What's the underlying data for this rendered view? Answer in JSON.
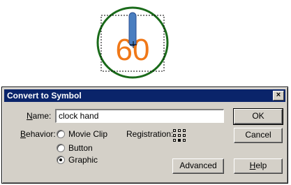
{
  "stage": {
    "symbol_text": "60",
    "circle_color": "#1a6b1a",
    "text_color": "#f07818",
    "hand_color": "#4a7ec0"
  },
  "dialog": {
    "title": "Convert to Symbol",
    "close_glyph": "×",
    "name_label_underlined": "N",
    "name_label_rest": "ame:",
    "name_value": "clock hand",
    "behavior_label_underlined": "B",
    "behavior_label_rest": "ehavior:",
    "behaviors": [
      {
        "label": "Movie Clip",
        "selected": false
      },
      {
        "label": "Button",
        "selected": false
      },
      {
        "label": "Graphic",
        "selected": true
      }
    ],
    "registration_label": "Registration:",
    "registration_selected": "bottom-center",
    "buttons": {
      "ok": "OK",
      "cancel": "Cancel",
      "advanced": "Advanced",
      "help_underlined": "H",
      "help_rest": "elp"
    }
  }
}
